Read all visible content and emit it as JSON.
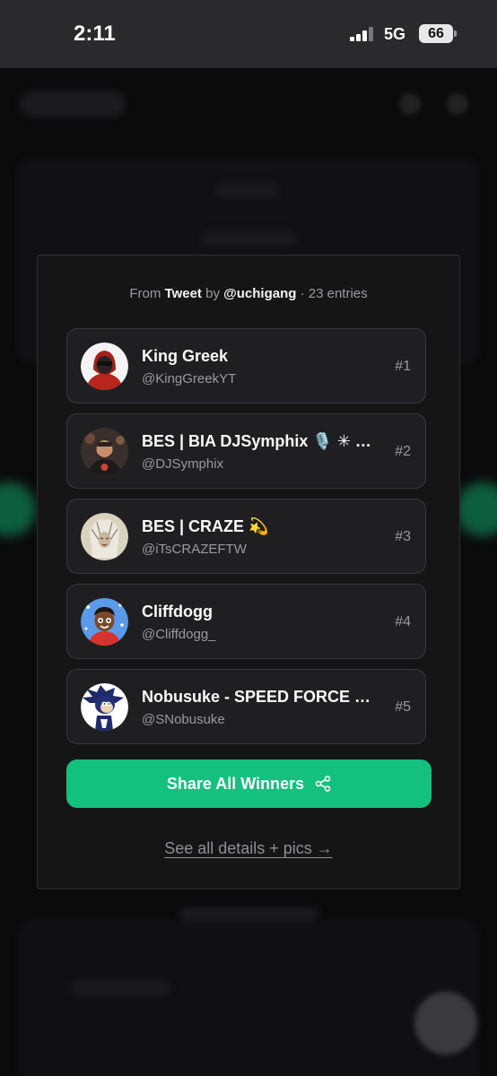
{
  "status_bar": {
    "time": "2:11",
    "network": "5G",
    "battery": "66"
  },
  "modal": {
    "source": {
      "prefix": "From",
      "source_type": "Tweet",
      "by": "by",
      "handle": "@uchigang",
      "entries": "· 23 entries"
    },
    "winners": [
      {
        "name": "King Greek",
        "handle": "@KingGreekYT",
        "rank": "#1"
      },
      {
        "name": "BES | BIA DJSymphix 🎙️ ✳ ➡ ...",
        "handle": "@DJSymphix",
        "rank": "#2"
      },
      {
        "name": "BES | CRAZE 💫",
        "handle": "@iTsCRAZEFTW",
        "rank": "#3"
      },
      {
        "name": "Cliffdogg",
        "handle": "@Cliffdogg_",
        "rank": "#4"
      },
      {
        "name": "Nobusuke - SPEED FORCE O...",
        "handle": "@SNobusuke",
        "rank": "#5"
      }
    ],
    "share_label": "Share All Winners",
    "details_link": "See all details + pics →"
  },
  "colors": {
    "accent": "#14c07e",
    "modal_bg": "#151516",
    "card_bg": "#1f1f21"
  }
}
